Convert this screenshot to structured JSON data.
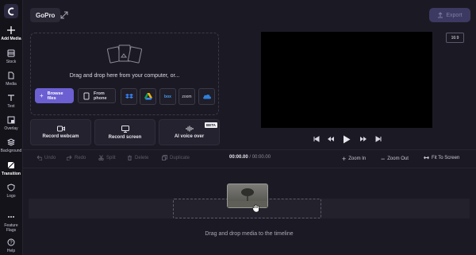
{
  "sidebar": {
    "logo_icon": "clipchamp-logo",
    "items": [
      {
        "label": "Add Media",
        "icon": "plus-icon",
        "active": true
      },
      {
        "label": "Stock",
        "icon": "film-icon"
      },
      {
        "label": "Media",
        "icon": "file-icon"
      },
      {
        "label": "Text",
        "icon": "text-icon"
      },
      {
        "label": "Overlay",
        "icon": "overlay-icon"
      },
      {
        "label": "Background",
        "icon": "layers-icon"
      },
      {
        "label": "Transition",
        "icon": "transition-icon",
        "active": true
      },
      {
        "label": "Logo",
        "icon": "shield-icon"
      },
      {
        "label": "Feature Flags",
        "icon": "dots-icon"
      },
      {
        "label": "Help",
        "icon": "help-icon"
      }
    ]
  },
  "header": {
    "project_name": "GoPro",
    "export_label": "Export"
  },
  "upload": {
    "drop_text": "Drag and drop here from your computer, or...",
    "browse_label": "Browse files",
    "from_phone_label": "From phone",
    "sources": [
      "dropbox-icon",
      "google-drive-icon",
      "box",
      "zoom",
      "onedrive-icon"
    ],
    "box_label": "box",
    "zoom_label": "zoom"
  },
  "actions": {
    "record_webcam": "Record webcam",
    "record_screen": "Record screen",
    "ai_voice": "AI voice over",
    "beta_badge": "BETA"
  },
  "preview": {
    "aspect_ratio": "16:9"
  },
  "toolbar": {
    "undo": "Undo",
    "redo": "Redo",
    "split": "Split",
    "delete": "Delete",
    "duplicate": "Duplicate",
    "time_current": "00:00.00",
    "time_separator": " / ",
    "time_total": "00:00.00",
    "zoom_in": "Zoom In",
    "zoom_out": "Zoom Out",
    "fit": "Fit To Screen"
  },
  "timeline": {
    "drop_text": "Drag and drop media to the timeline"
  },
  "colors": {
    "accent": "#6b5fd2",
    "background": "#1b1a24",
    "export_disabled": "#3c3a63"
  }
}
